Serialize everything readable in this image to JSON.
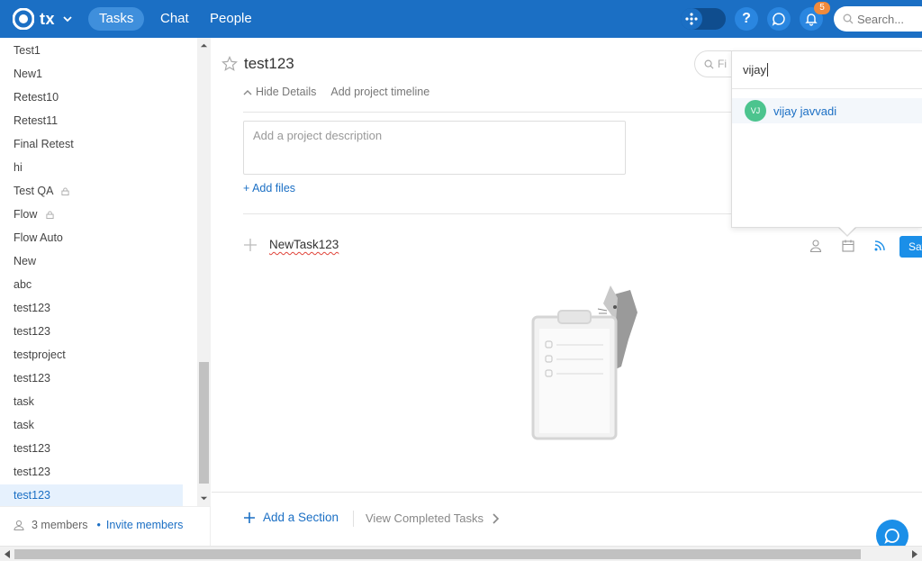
{
  "topbar": {
    "logo_text": "tx",
    "tabs": [
      {
        "label": "Tasks",
        "active": true
      },
      {
        "label": "Chat",
        "active": false
      },
      {
        "label": "People",
        "active": false
      }
    ],
    "help_label": "?",
    "notification_count": "5",
    "search_placeholder": "Search..."
  },
  "sidebar": {
    "projects": [
      {
        "label": "Test1"
      },
      {
        "label": "New1"
      },
      {
        "label": "Retest10"
      },
      {
        "label": "Retest11"
      },
      {
        "label": "Final Retest"
      },
      {
        "label": "hi"
      },
      {
        "label": "Test QA",
        "locked": true
      },
      {
        "label": "Flow",
        "locked": true
      },
      {
        "label": "Flow Auto"
      },
      {
        "label": "New"
      },
      {
        "label": "abc"
      },
      {
        "label": "test123"
      },
      {
        "label": "test123"
      },
      {
        "label": "testproject"
      },
      {
        "label": "test123"
      },
      {
        "label": "task"
      },
      {
        "label": "task"
      },
      {
        "label": "test123"
      },
      {
        "label": "test123"
      },
      {
        "label": "test123",
        "active": true
      }
    ],
    "members_label": "3 members",
    "invite_label": "Invite members"
  },
  "main": {
    "project_title": "test123",
    "filter_placeholder": "Fi",
    "hide_details_label": "Hide Details",
    "add_timeline_label": "Add project timeline",
    "description_placeholder": "Add a project description",
    "add_files_label": "Add files",
    "task_name": "NewTask123",
    "save_label": "Sav",
    "add_section_label": "Add a Section",
    "view_completed_label": "View Completed Tasks"
  },
  "assign_popup": {
    "query": "vijay",
    "results": [
      {
        "initials": "VJ",
        "name": "vijay javvadi",
        "avatar_color": "#4cc48e"
      }
    ]
  },
  "colors": {
    "brand": "#1b6fc4",
    "accent": "#1b8fe8",
    "badge": "#f08a3c"
  }
}
